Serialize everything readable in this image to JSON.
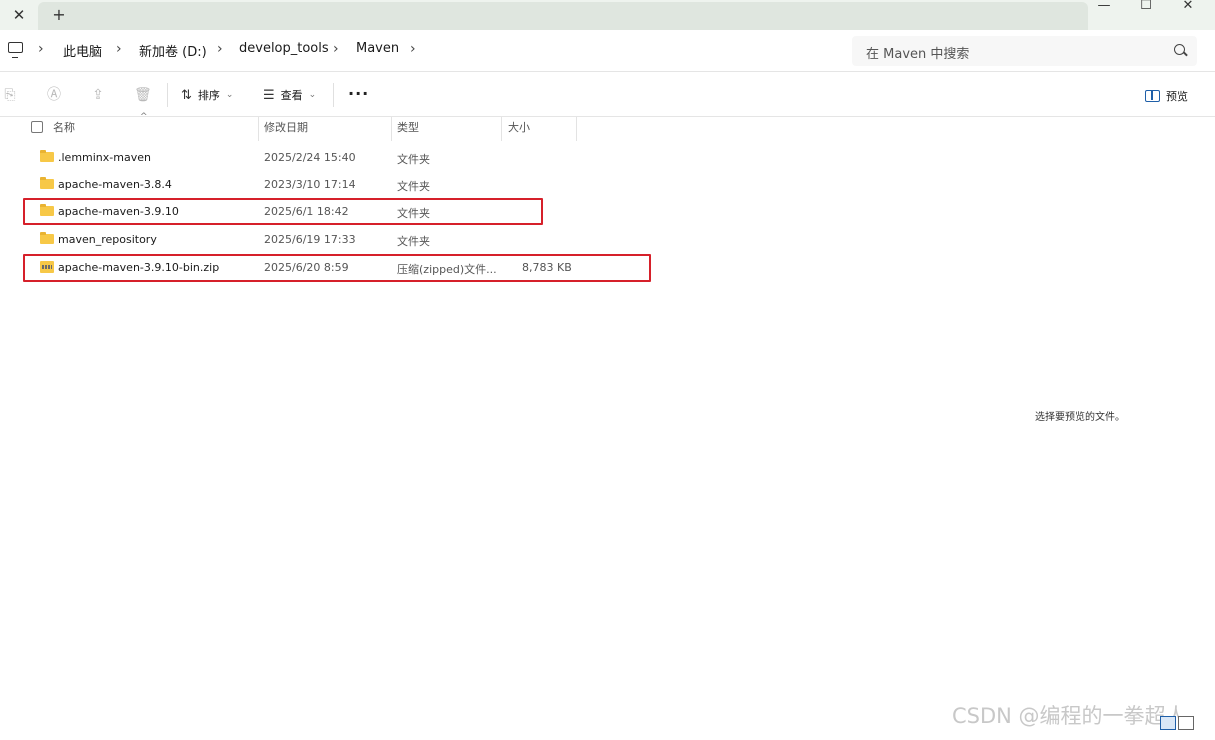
{
  "tabbar": {
    "close_glyph": "✕",
    "new_tab_glyph": "+",
    "minimize_glyph": "—",
    "maximize_glyph": "☐",
    "window_close_glyph": "✕"
  },
  "address": {
    "breadcrumb": [
      "此电脑",
      "新加卷 (D:)",
      "develop_tools",
      "Maven"
    ],
    "separator": "›",
    "search_placeholder": "在 Maven 中搜索"
  },
  "toolbar": {
    "sort_label": "排序",
    "view_label": "查看",
    "more_label": "···",
    "preview_label": "预览",
    "disabled_icons": [
      "paste-icon",
      "rename-icon",
      "share-icon",
      "delete-icon"
    ]
  },
  "columns": {
    "name": "名称",
    "date": "修改日期",
    "type": "类型",
    "size": "大小",
    "sort_indicator": "^"
  },
  "files": [
    {
      "icon": "folder-icon",
      "name": ".lemminx-maven",
      "date": "2025/2/24 15:40",
      "type": "文件夹",
      "size": ""
    },
    {
      "icon": "folder-icon",
      "name": "apache-maven-3.8.4",
      "date": "2023/3/10 17:14",
      "type": "文件夹",
      "size": ""
    },
    {
      "icon": "folder-icon",
      "name": "apache-maven-3.9.10",
      "date": "2025/6/1 18:42",
      "type": "文件夹",
      "size": ""
    },
    {
      "icon": "folder-icon",
      "name": "maven_repository",
      "date": "2025/6/19 17:33",
      "type": "文件夹",
      "size": ""
    },
    {
      "icon": "zip-icon",
      "name": "apache-maven-3.9.10-bin.zip",
      "date": "2025/6/20 8:59",
      "type": "压缩(zipped)文件...",
      "size": "8,783 KB"
    }
  ],
  "preview_pane": {
    "message": "选择要预览的文件。"
  },
  "watermark": "CSDN @编程的一拳超人",
  "colors": {
    "highlight_border": "#d6202a",
    "folder": "#f7c847",
    "accent": "#1f5fa8"
  }
}
